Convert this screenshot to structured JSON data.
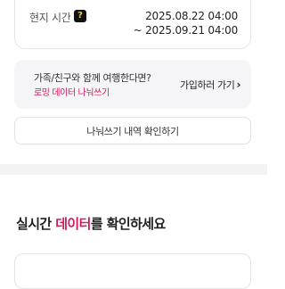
{
  "local_time": {
    "label": "현지 시간",
    "help_icon": "question-icon",
    "help_glyph": "?",
    "start": "2025.08.22 04:00",
    "end": "~ 2025.09.21 04:00"
  },
  "share_banner": {
    "title": "가족/친구와 함께 여행한다면?",
    "subtitle": "로밍 데이터 나눠쓰기",
    "link_label": "가입하러 가기",
    "link_icon": "chevron-right-icon",
    "link_glyph": "›"
  },
  "history_button": {
    "label": "나눠쓰기 내역 확인하기"
  },
  "realtime": {
    "prefix": "실시간 ",
    "highlight": "데이터",
    "suffix": "를 확인하세요"
  },
  "colors": {
    "accent": "#d6185f",
    "help_icon_bg": "#111111",
    "help_icon_fg": "#f6c945",
    "banner_bg": "#f5f5f7",
    "divider": "#f3f3f5"
  }
}
